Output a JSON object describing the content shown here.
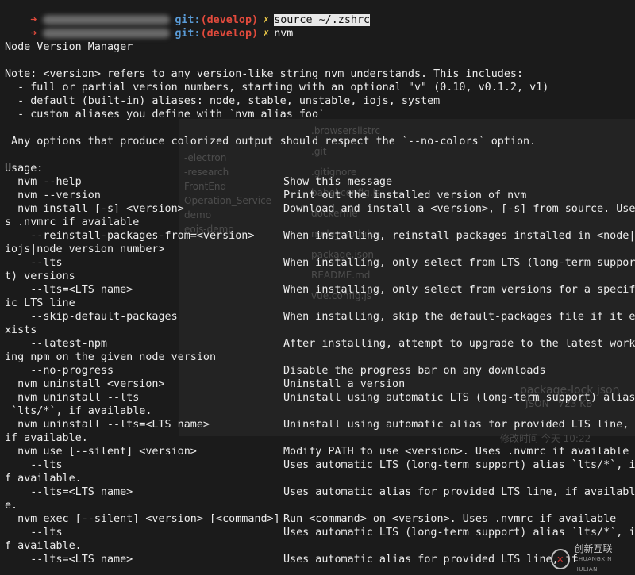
{
  "prompts": [
    {
      "git": "git:",
      "branch": "(develop)",
      "x": "✗",
      "command": "source ~/.zshrc",
      "selected": true
    },
    {
      "git": "git:",
      "branch": "(develop)",
      "x": "✗",
      "command": "nvm",
      "selected": false
    }
  ],
  "lines": [
    "Node Version Manager",
    "",
    "Note: <version> refers to any version-like string nvm understands. This includes:",
    "  - full or partial version numbers, starting with an optional \"v\" (0.10, v0.1.2, v1)",
    "  - default (built-in) aliases: node, stable, unstable, iojs, system",
    "  - custom aliases you define with `nvm alias foo`",
    "",
    " Any options that produce colorized output should respect the `--no-colors` option.",
    "",
    "Usage:"
  ],
  "usage": [
    {
      "cmd": "  nvm --help",
      "desc": "Show this message"
    },
    {
      "cmd": "  nvm --version",
      "desc": "Print out the installed version of nvm"
    },
    {
      "cmd": "  nvm install [-s] <version>",
      "desc": "Download and install a <version>, [-s] from source. Use"
    },
    {
      "cmd": "s .nvmrc if available",
      "desc": ""
    },
    {
      "cmd": "    --reinstall-packages-from=<version>",
      "desc": "When installing, reinstall packages installed in <node|"
    },
    {
      "cmd": "iojs|node version number>",
      "desc": ""
    },
    {
      "cmd": "    --lts",
      "desc": "When installing, only select from LTS (long-term suppor"
    },
    {
      "cmd": "t) versions",
      "desc": ""
    },
    {
      "cmd": "    --lts=<LTS name>",
      "desc": "When installing, only select from versions for a specif"
    },
    {
      "cmd": "ic LTS line",
      "desc": ""
    },
    {
      "cmd": "    --skip-default-packages",
      "desc": "When installing, skip the default-packages file if it e"
    },
    {
      "cmd": "xists",
      "desc": ""
    },
    {
      "cmd": "    --latest-npm",
      "desc": "After installing, attempt to upgrade to the latest work"
    },
    {
      "cmd": "ing npm on the given node version",
      "desc": ""
    },
    {
      "cmd": "    --no-progress",
      "desc": "Disable the progress bar on any downloads"
    },
    {
      "cmd": "  nvm uninstall <version>",
      "desc": "Uninstall a version"
    },
    {
      "cmd": "  nvm uninstall --lts",
      "desc": "Uninstall using automatic LTS (long-term support) alias"
    },
    {
      "cmd": " `lts/*`, if available.",
      "desc": ""
    },
    {
      "cmd": "  nvm uninstall --lts=<LTS name>",
      "desc": "Uninstall using automatic alias for provided LTS line,"
    },
    {
      "cmd": "if available.",
      "desc": ""
    },
    {
      "cmd": "  nvm use [--silent] <version>",
      "desc": "Modify PATH to use <version>. Uses .nvmrc if available"
    },
    {
      "cmd": "    --lts",
      "desc": "Uses automatic LTS (long-term support) alias `lts/*`, i"
    },
    {
      "cmd": "f available.",
      "desc": ""
    },
    {
      "cmd": "    --lts=<LTS name>",
      "desc": "Uses automatic alias for provided LTS line, if availabl"
    },
    {
      "cmd": "e.",
      "desc": ""
    },
    {
      "cmd": "  nvm exec [--silent] <version> [<command>]",
      "desc": "Run <command> on <version>. Uses .nvmrc if available"
    },
    {
      "cmd": "    --lts",
      "desc": "Uses automatic LTS (long-term support) alias `lts/*`, i"
    },
    {
      "cmd": "f available.",
      "desc": ""
    },
    {
      "cmd": "    --lts=<LTS name>",
      "desc": "Uses automatic alias for provided LTS line, if"
    }
  ],
  "background_ghost": {
    "files": [
      ".browserslistrc",
      ".git",
      ".gitignore",
      "babel.config.js",
      "dockerfile",
      "node_modules",
      "package.json",
      "README.md",
      "vue.config.js"
    ],
    "sidebar": [
      "-electron",
      "-research",
      "FrontEnd",
      "Operation_Service",
      "demo",
      "eojs-demo"
    ],
    "file_name": "package-lock.json",
    "file_meta": "JSON - 723 KB",
    "modified": "修改时间  今天 10:22"
  },
  "watermark": {
    "brand": "创新互联"
  },
  "colors": {
    "arrow": "#e04a3c",
    "git": "#5a9bd6",
    "branch": "#e04a3c",
    "dirty": "#e8c547",
    "text": "#ececec",
    "background": "#1b1b1b"
  }
}
